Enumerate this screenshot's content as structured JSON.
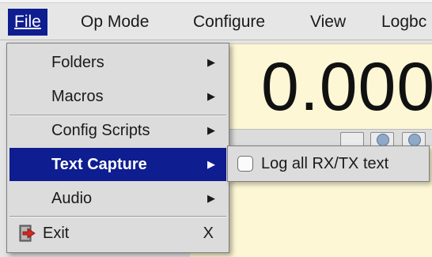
{
  "menubar": {
    "file": "File",
    "opmode": "Op Mode",
    "configure": "Configure",
    "view": "View",
    "logbook": "Logbc"
  },
  "frequency": {
    "display": "0.000"
  },
  "file_menu": {
    "items": [
      {
        "label": "Folders"
      },
      {
        "label": "Macros"
      },
      {
        "label": "Config Scripts"
      },
      {
        "label": "Text Capture"
      },
      {
        "label": "Audio"
      },
      {
        "label": "Exit",
        "shortcut": "X",
        "icon": "exit-icon"
      }
    ],
    "submenu_arrow": "▶"
  },
  "text_capture_submenu": {
    "items": [
      {
        "label": "Log all RX/TX text",
        "checked": false
      }
    ]
  },
  "colors": {
    "selection": "#0e1d8f",
    "panel_bg": "#fdf7d5",
    "menu_bg": "#dcdcdc"
  }
}
